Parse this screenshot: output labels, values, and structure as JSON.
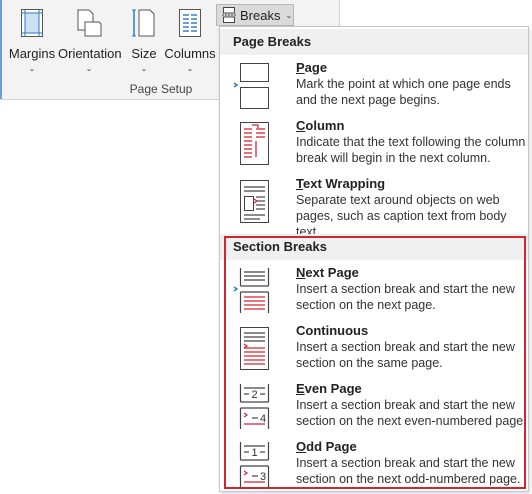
{
  "ribbon": {
    "buttons": [
      {
        "key": "margins",
        "label": "Margins"
      },
      {
        "key": "orientation",
        "label": "Orientation"
      },
      {
        "key": "size",
        "label": "Size"
      },
      {
        "key": "columns",
        "label": "Columns"
      }
    ],
    "group_label": "Page Setup",
    "breaks_label": "Breaks"
  },
  "menu": {
    "page_breaks": {
      "header": "Page Breaks",
      "items": [
        {
          "accel": "P",
          "rest": "age",
          "desc": "Mark the point at which one page ends and the next page begins.",
          "icon": "page-break-icon"
        },
        {
          "accel": "C",
          "rest": "olumn",
          "desc": "Indicate that the text following the column break will begin in the next column.",
          "icon": "column-break-icon"
        },
        {
          "accel": "T",
          "rest": "ext Wrapping",
          "desc": "Separate text around objects on web pages, such as caption text from body text.",
          "icon": "text-wrapping-icon"
        }
      ]
    },
    "section_breaks": {
      "header": "Section Breaks",
      "items": [
        {
          "accel": "N",
          "rest": "ext Page",
          "desc": "Insert a section break and start the new section on the next page.",
          "icon": "next-page-section-icon"
        },
        {
          "accel": "",
          "rest": "Continuous",
          "desc": "Insert a section break and start the new section on the same page.",
          "icon": "continuous-section-icon"
        },
        {
          "accel": "E",
          "rest": "ven Page",
          "desc": "Insert a section break and start the new section on the next even-numbered page.",
          "icon": "even-page-section-icon",
          "num_top": "2",
          "num_bottom": "4"
        },
        {
          "accel": "O",
          "rest": "dd Page",
          "desc": "Insert a section break and start the new section on the next odd-numbered page.",
          "icon": "odd-page-section-icon",
          "num_top": "1",
          "num_bottom": "3"
        }
      ]
    }
  },
  "colors": {
    "accent_red": "#d32530",
    "accent_blue": "#2b79c2",
    "ribbon_bg": "#f3f3f3"
  }
}
